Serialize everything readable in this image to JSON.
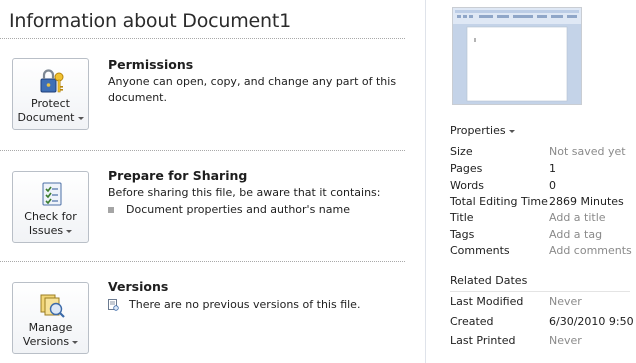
{
  "page": {
    "title": "Information about Document1"
  },
  "sections": {
    "permissions": {
      "button_line1": "Protect",
      "button_line2": "Document",
      "title": "Permissions",
      "description": "Anyone can open, copy, and change any part of this document.",
      "icon": "lock-key-icon"
    },
    "sharing": {
      "button_line1": "Check for",
      "button_line2": "Issues",
      "title": "Prepare for Sharing",
      "description": "Before sharing this file, be aware that it contains:",
      "items": [
        "Document properties and author's name"
      ],
      "icon": "checklist-icon"
    },
    "versions": {
      "button_line1": "Manage",
      "button_line2": "Versions",
      "title": "Versions",
      "description": "There are no previous versions of this file.",
      "icon": "versions-icon"
    }
  },
  "properties": {
    "heading": "Properties",
    "rows": [
      {
        "label": "Size",
        "value": "Not saved yet"
      },
      {
        "label": "Pages",
        "value": "1"
      },
      {
        "label": "Words",
        "value": "0"
      },
      {
        "label": "Total Editing Time",
        "value": "2869 Minutes"
      },
      {
        "label": "Title",
        "value": "Add a title"
      },
      {
        "label": "Tags",
        "value": "Add a tag"
      },
      {
        "label": "Comments",
        "value": "Add comments"
      }
    ]
  },
  "related_dates": {
    "heading": "Related Dates",
    "rows": [
      {
        "label": "Last Modified",
        "value": "Never"
      },
      {
        "label": "Created",
        "value": "6/30/2010 9:50 ..."
      },
      {
        "label": "Last Printed",
        "value": "Never"
      }
    ]
  },
  "colors": {
    "muted": "#8a8a8a",
    "border": "#b9bfc7"
  }
}
